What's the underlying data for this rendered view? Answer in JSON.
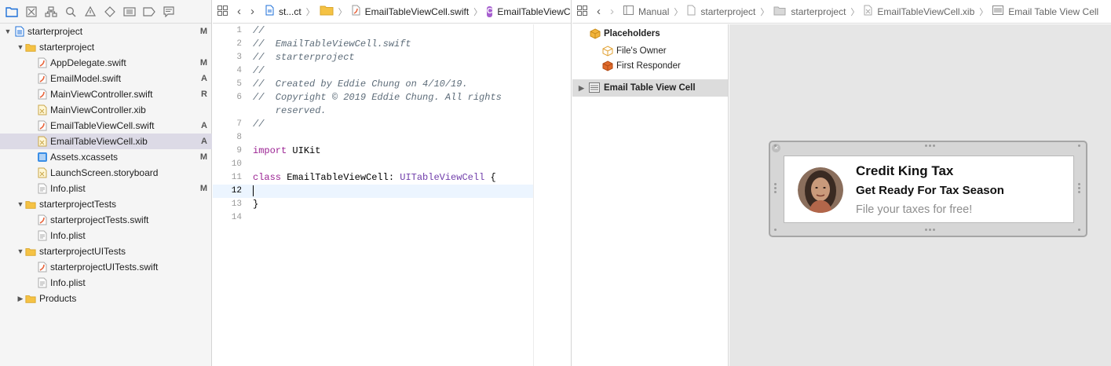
{
  "navigator": {
    "toolbar_icons": [
      "folder-icon",
      "source-control-icon",
      "symbol-icon",
      "search-icon",
      "issue-icon",
      "test-icon",
      "debug-icon",
      "breakpoint-icon",
      "report-icon"
    ],
    "tree": [
      {
        "label": "starterproject",
        "status": "M",
        "type": "project",
        "level": 0,
        "expanded": true
      },
      {
        "label": "starterproject",
        "status": "",
        "type": "folder",
        "level": 1,
        "expanded": true
      },
      {
        "label": "AppDelegate.swift",
        "status": "M",
        "type": "swift",
        "level": 2
      },
      {
        "label": "EmailModel.swift",
        "status": "A",
        "type": "swift",
        "level": 2
      },
      {
        "label": "MainViewController.swift",
        "status": "R",
        "type": "swift",
        "level": 2
      },
      {
        "label": "MainViewController.xib",
        "status": "",
        "type": "xib",
        "level": 2
      },
      {
        "label": "EmailTableViewCell.swift",
        "status": "A",
        "type": "swift",
        "level": 2
      },
      {
        "label": "EmailTableViewCell.xib",
        "status": "A",
        "type": "xib",
        "level": 2,
        "selected": true
      },
      {
        "label": "Assets.xcassets",
        "status": "M",
        "type": "assets",
        "level": 2
      },
      {
        "label": "LaunchScreen.storyboard",
        "status": "",
        "type": "xib",
        "level": 2
      },
      {
        "label": "Info.plist",
        "status": "M",
        "type": "plist",
        "level": 2
      },
      {
        "label": "starterprojectTests",
        "status": "",
        "type": "folder",
        "level": 1,
        "expanded": true
      },
      {
        "label": "starterprojectTests.swift",
        "status": "",
        "type": "swift",
        "level": 2
      },
      {
        "label": "Info.plist",
        "status": "",
        "type": "plist",
        "level": 2
      },
      {
        "label": "starterprojectUITests",
        "status": "",
        "type": "folder",
        "level": 1,
        "expanded": true
      },
      {
        "label": "starterprojectUITests.swift",
        "status": "",
        "type": "swift",
        "level": 2
      },
      {
        "label": "Info.plist",
        "status": "",
        "type": "plist",
        "level": 2
      },
      {
        "label": "Products",
        "status": "",
        "type": "folder",
        "level": 1,
        "expanded": false
      }
    ]
  },
  "editor": {
    "jumpbar": {
      "project": "st...ct",
      "file": "EmailTableViewCell.swift",
      "symbol": "EmailTableViewCell",
      "symbol_badge": "C"
    },
    "lines": [
      {
        "num": "1",
        "segments": [
          {
            "t": "//",
            "c": "comment"
          }
        ]
      },
      {
        "num": "2",
        "segments": [
          {
            "t": "//  EmailTableViewCell.swift",
            "c": "comment"
          }
        ]
      },
      {
        "num": "3",
        "segments": [
          {
            "t": "//  starterproject",
            "c": "comment"
          }
        ]
      },
      {
        "num": "4",
        "segments": [
          {
            "t": "//",
            "c": "comment"
          }
        ]
      },
      {
        "num": "5",
        "segments": [
          {
            "t": "//  Created by Eddie Chung on 4/10/19.",
            "c": "comment"
          }
        ]
      },
      {
        "num": "6",
        "segments": [
          {
            "t": "//  Copyright © 2019 Eddie Chung. All rights",
            "c": "comment"
          }
        ]
      },
      {
        "num": "",
        "segments": [
          {
            "t": "    reserved.",
            "c": "comment"
          }
        ]
      },
      {
        "num": "7",
        "segments": [
          {
            "t": "//",
            "c": "comment"
          }
        ]
      },
      {
        "num": "8",
        "segments": []
      },
      {
        "num": "9",
        "segments": [
          {
            "t": "import",
            "c": "kw"
          },
          {
            "t": " UIKit",
            "c": "plain"
          }
        ]
      },
      {
        "num": "10",
        "segments": []
      },
      {
        "num": "11",
        "segments": [
          {
            "t": "class",
            "c": "kw"
          },
          {
            "t": " EmailTableViewCell: ",
            "c": "plain"
          },
          {
            "t": "UITableViewCell",
            "c": "type"
          },
          {
            "t": " {",
            "c": "plain"
          }
        ]
      },
      {
        "num": "12",
        "segments": [],
        "current": true
      },
      {
        "num": "13",
        "segments": [
          {
            "t": "}",
            "c": "plain"
          }
        ]
      },
      {
        "num": "14",
        "segments": []
      }
    ]
  },
  "ib": {
    "jumpbar": {
      "manual": "Manual",
      "project": "starterproject",
      "folder": "starterproject",
      "file": "EmailTableViewCell.xib",
      "object": "Email Table View Cell"
    },
    "outline": {
      "placeholders": "Placeholders",
      "files_owner": "File's Owner",
      "first_responder": "First Responder",
      "cell": "Email Table View Cell"
    },
    "cell": {
      "title": "Credit King Tax",
      "subtitle": "Get Ready For Tax Season",
      "detail": "File your taxes for free!"
    }
  },
  "colors": {
    "selection": "#dcdae6",
    "keyword": "#9b2393",
    "type": "#703daa",
    "comment": "#5d6c79",
    "folder": "#f5c244",
    "accent": "#1c6fd8"
  }
}
